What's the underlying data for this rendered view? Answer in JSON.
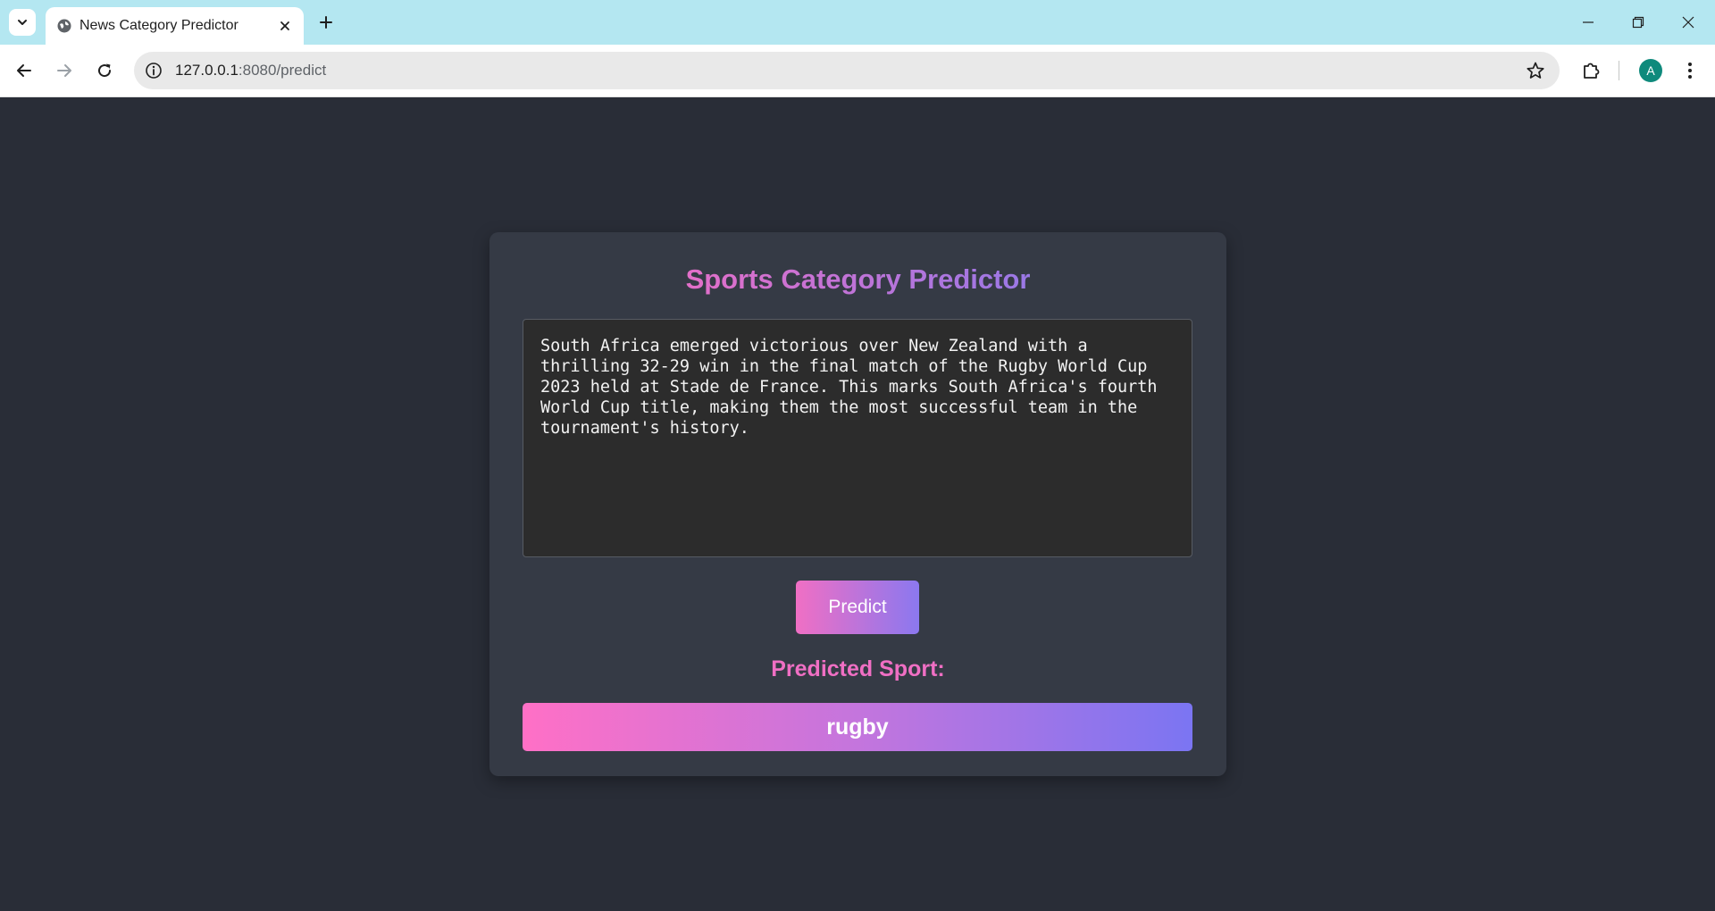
{
  "browser": {
    "tab_title": "News Category Predictor",
    "url_host": "127.0.0.1",
    "url_path": ":8080/predict",
    "avatar_letter": "A",
    "icons": {
      "tab_search": "chevron-down-icon",
      "favicon": "globe-icon",
      "tab_close": "close-icon",
      "new_tab": "plus-icon",
      "back": "arrow-left-icon",
      "forward": "arrow-right-icon",
      "reload": "reload-icon",
      "site_info": "info-icon",
      "bookmark": "star-icon",
      "extensions": "puzzle-icon",
      "menu": "kebab-menu-icon",
      "minimize": "minimize-icon",
      "restore": "restore-icon",
      "close_window": "close-icon"
    },
    "colors": {
      "tabbar": "#b4e7f1",
      "avatar": "#0f8a7c"
    }
  },
  "page": {
    "title": "Sports Category Predictor",
    "input_text": "South Africa emerged victorious over New Zealand with a thrilling 32-29 win in the final match of the Rugby World Cup 2023 held at Stade de France. This marks South Africa's fourth World Cup title, making them the most successful team in the tournament's history.",
    "predict_label": "Predict",
    "result_label": "Predicted Sport:",
    "result_value": "rugby",
    "colors": {
      "background": "#292d37",
      "card": "#353a45",
      "accent_pink": "#f06fc4",
      "accent_purple": "#7b75f2"
    }
  }
}
